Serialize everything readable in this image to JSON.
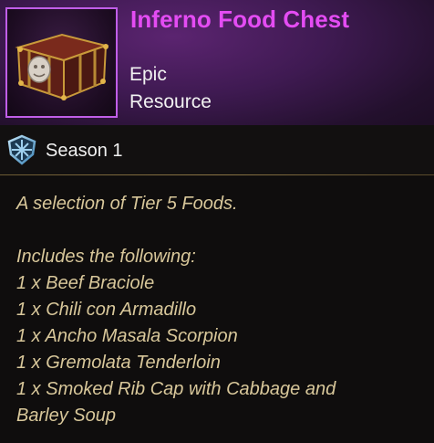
{
  "item": {
    "name": "Inferno Food Chest",
    "rarity": "Epic",
    "type": "Resource",
    "icon": "treasure-chest-icon"
  },
  "season": {
    "label": "Season 1",
    "icon": "season-shield-icon"
  },
  "description": {
    "summary": "A selection of Tier 5 Foods.",
    "includes_header": "Includes the following:",
    "items": [
      "1 x Beef Braciole",
      "1 x Chili con Armadillo",
      "1 x Ancho Masala Scorpion",
      "1 x Gremolata Tenderloin",
      "1 x Smoked Rib Cap with Cabbage and",
      "Barley Soup"
    ]
  },
  "colors": {
    "title": "#e44cf3",
    "description_text": "#d8c79a",
    "frame_border": "#c05ee8",
    "header_bg": "#3f1a52"
  }
}
